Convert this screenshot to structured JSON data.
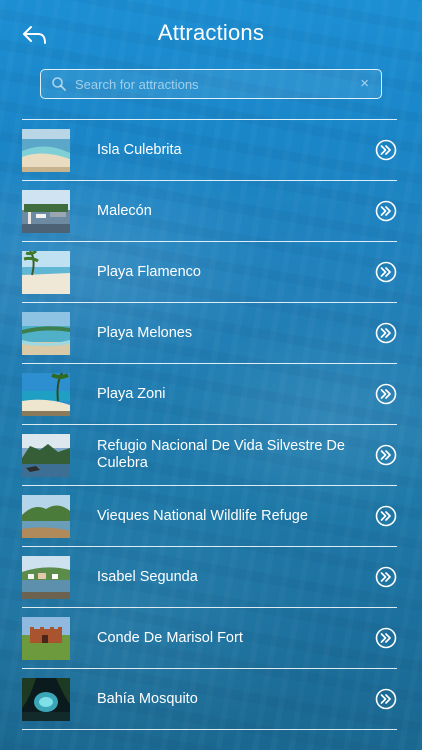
{
  "header": {
    "title": "Attractions",
    "back_icon": "back-arrow-icon"
  },
  "search": {
    "placeholder": "Search for attractions",
    "value": "",
    "clear_icon": "×"
  },
  "attractions": [
    {
      "name": "Isla Culebrita",
      "thumb": "beach-aerial"
    },
    {
      "name": "Malecón",
      "thumb": "harbor"
    },
    {
      "name": "Playa Flamenco",
      "thumb": "palm-beach"
    },
    {
      "name": "Playa Melones",
      "thumb": "shallow-water"
    },
    {
      "name": "Playa Zoni",
      "thumb": "beach-palm"
    },
    {
      "name": "Refugio Nacional De Vida Silvestre De Culebra",
      "thumb": "rocky-coast"
    },
    {
      "name": "Vieques National Wildlife Refuge",
      "thumb": "mangrove"
    },
    {
      "name": "Isabel Segunda",
      "thumb": "town-coast"
    },
    {
      "name": "Conde De Marisol Fort",
      "thumb": "fort"
    },
    {
      "name": "Bahía Mosquito",
      "thumb": "night-bay"
    }
  ],
  "colors": {
    "background": "#1f80b8",
    "text": "#ffffff",
    "divider": "#ffffff"
  }
}
